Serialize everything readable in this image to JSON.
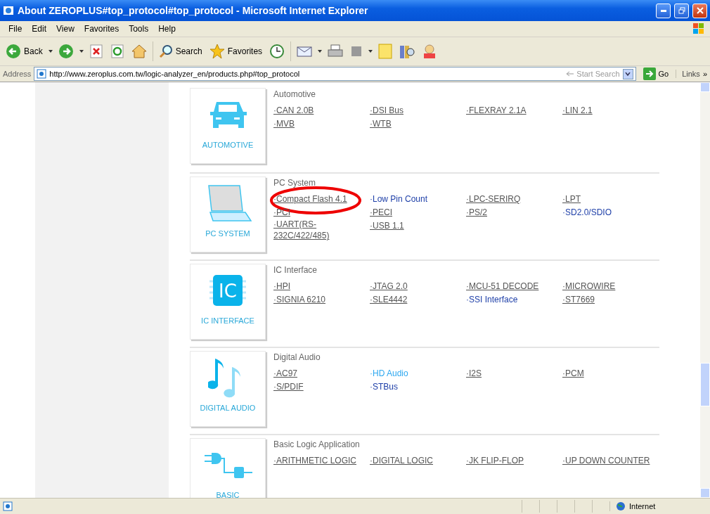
{
  "window": {
    "title": "About ZEROPLUS#top_protocol#top_protocol - Microsoft Internet Explorer"
  },
  "menu": [
    "File",
    "Edit",
    "View",
    "Favorites",
    "Tools",
    "Help"
  ],
  "toolbar": {
    "back": "Back",
    "search": "Search",
    "favorites": "Favorites"
  },
  "address_bar": {
    "label": "Address",
    "url": "http://www.zeroplus.com.tw/logic-analyzer_en/products.php#top_protocol",
    "search_placeholder": "Start Search",
    "go": "Go",
    "links": "Links",
    "links_more": "»"
  },
  "sections": [
    {
      "card_label": "AUTOMOTIVE",
      "title": "Automotive",
      "links": [
        {
          "label": "·CAN 2.0B",
          "kind": "visited",
          "circled": false
        },
        {
          "label": "·DSI Bus",
          "kind": "visited",
          "circled": false
        },
        {
          "label": "·FLEXRAY 2.1A",
          "kind": "visited",
          "circled": false
        },
        {
          "label": "·LIN 2.1",
          "kind": "visited",
          "circled": false
        },
        {
          "label": "·MVB",
          "kind": "visited",
          "circled": false
        },
        {
          "label": "·WTB",
          "kind": "visited",
          "circled": false
        }
      ]
    },
    {
      "card_label": "PC SYSTEM",
      "title": "PC System",
      "links": [
        {
          "label": "·Compact Flash 4.1",
          "kind": "visited",
          "circled": true
        },
        {
          "label": "·Low Pin Count",
          "kind": "new",
          "circled": false
        },
        {
          "label": "·LPC-SERIRQ",
          "kind": "visited",
          "circled": false
        },
        {
          "label": "·LPT",
          "kind": "visited",
          "circled": false
        },
        {
          "label": "·PCI",
          "kind": "visited",
          "circled": false
        },
        {
          "label": "·PECI",
          "kind": "visited",
          "circled": false
        },
        {
          "label": "·PS/2",
          "kind": "visited",
          "circled": false
        },
        {
          "label": "·SD2.0/SDIO",
          "kind": "new",
          "circled": false
        },
        {
          "label": "·UART(RS-232C/422/485)",
          "kind": "visited",
          "circled": false
        },
        {
          "label": "·USB 1.1",
          "kind": "visited",
          "circled": false
        }
      ]
    },
    {
      "icon_text": "IC",
      "card_label": "IC INTERFACE",
      "title": "IC Interface",
      "links": [
        {
          "label": "·HPI",
          "kind": "visited",
          "circled": false
        },
        {
          "label": "·JTAG 2.0",
          "kind": "visited",
          "circled": false
        },
        {
          "label": "·MCU-51 DECODE",
          "kind": "visited",
          "circled": false
        },
        {
          "label": "·MICROWIRE",
          "kind": "visited",
          "circled": false
        },
        {
          "label": "·SIGNIA 6210",
          "kind": "visited",
          "circled": false
        },
        {
          "label": "·SLE4442",
          "kind": "visited",
          "circled": false
        },
        {
          "label": "·SSI Interface",
          "kind": "new",
          "circled": false
        },
        {
          "label": "·ST7669",
          "kind": "visited",
          "circled": false
        }
      ]
    },
    {
      "card_label": "DIGITAL AUDIO",
      "title": "Digital Audio",
      "links": [
        {
          "label": "·AC97",
          "kind": "visited",
          "circled": false
        },
        {
          "label": "·HD Audio",
          "kind": "hover",
          "circled": false
        },
        {
          "label": "·I2S",
          "kind": "visited",
          "circled": false
        },
        {
          "label": "·PCM",
          "kind": "visited",
          "circled": false
        },
        {
          "label": "·S/PDIF",
          "kind": "visited",
          "circled": false
        },
        {
          "label": "·STBus",
          "kind": "new",
          "circled": false
        }
      ]
    },
    {
      "card_label": "BASIC",
      "title": "Basic Logic Application",
      "links": [
        {
          "label": "·ARITHMETIC LOGIC",
          "kind": "visited",
          "circled": false
        },
        {
          "label": "·DIGITAL LOGIC",
          "kind": "visited",
          "circled": false
        },
        {
          "label": "·JK FLIP-FLOP",
          "kind": "visited",
          "circled": false
        },
        {
          "label": "·UP DOWN COUNTER",
          "kind": "visited",
          "circled": false
        }
      ]
    }
  ],
  "status_bar": {
    "zone": "Internet"
  }
}
